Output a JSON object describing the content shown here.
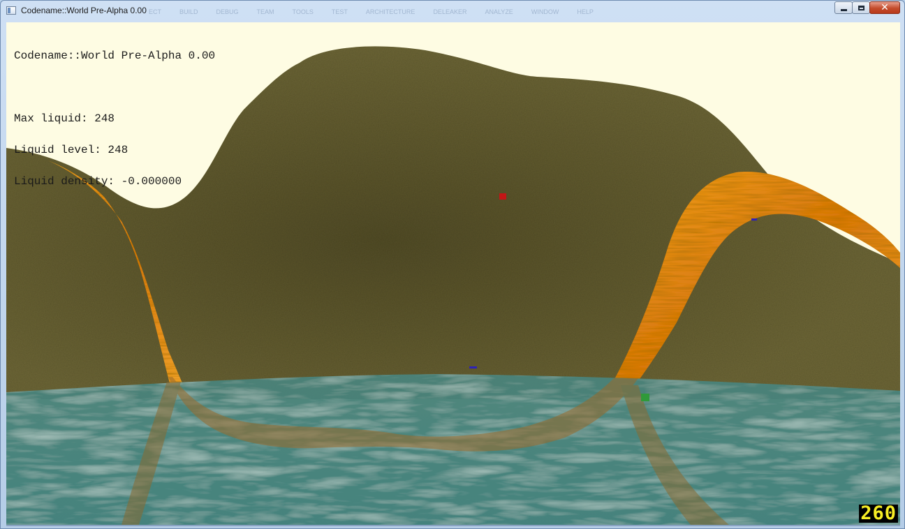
{
  "window": {
    "title": "Codename::World Pre-Alpha 0.00",
    "ghost_menu": [
      "ECT",
      "BUILD",
      "DEBUG",
      "TEAM",
      "TOOLS",
      "TEST",
      "ARCHITECTURE",
      "DELEAKER",
      "ANALYZE",
      "WINDOW",
      "HELP"
    ],
    "controls": {
      "minimize": "minimize",
      "maximize": "maximize",
      "close": "✕"
    }
  },
  "hud": {
    "title": "Codename::World Pre-Alpha 0.00",
    "max_liquid": "Max liquid: 248",
    "liquid_level": "Liquid level: 248",
    "liquid_density": "Liquid density: -0.000000"
  },
  "fps_counter": "260",
  "colors": {
    "sky": "#fefce3",
    "terrain": "#6c6535",
    "water": "#4f8a80",
    "lava_ribbon": "#e3861a",
    "fps_background": "#000000",
    "fps_text": "#f7ee25",
    "marker_red": "#c21616",
    "marker_blue": "#2d22b8",
    "marker_green": "#2f9a3a"
  }
}
